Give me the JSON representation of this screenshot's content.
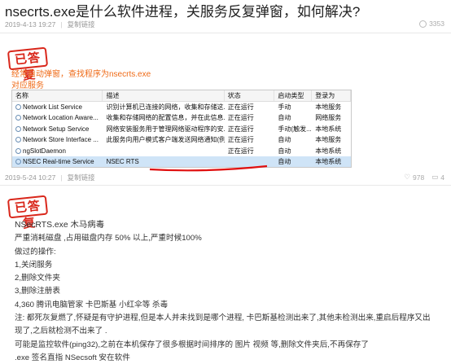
{
  "question": {
    "title": "nsecrts.exe是什么软件进程，关服务反复弹窗，如何解决?",
    "date": "2019-4-13 19:27",
    "copy_link": "复制链接",
    "views": "3353"
  },
  "answer1": {
    "stamp": "已答复",
    "line1": "经常自动弹窗，查找程序为nsecrts.exe",
    "line2": "对应服务",
    "services": {
      "headers": [
        "名称",
        "描述",
        "状态",
        "启动类型",
        "登录为"
      ],
      "rows": [
        {
          "name": "Network List Service",
          "desc": "识别计算机已连接的网络，收集和存储这...",
          "status": "正在运行",
          "startup": "手动",
          "logon": "本地服务",
          "selected": false
        },
        {
          "name": "Network Location Aware...",
          "desc": "收集和存储网络的配置信息，并在此信息...",
          "status": "正在运行",
          "startup": "自动",
          "logon": "网络服务",
          "selected": false
        },
        {
          "name": "Network Setup Service",
          "desc": "网络安装服务用于管理网络驱动程序的安...",
          "status": "正在运行",
          "startup": "手动(触发...",
          "logon": "本地系统",
          "selected": false
        },
        {
          "name": "Network Store Interface ...",
          "desc": "此服务向用户模式客户端发送网络通知(例...",
          "status": "正在运行",
          "startup": "自动",
          "logon": "本地服务",
          "selected": false
        },
        {
          "name": "ngSlotDaemon",
          "desc": "",
          "status": "正在运行",
          "startup": "自动",
          "logon": "本地系统",
          "selected": false
        },
        {
          "name": "NSEC Real-time Service",
          "desc": "NSEC RTS",
          "status": "",
          "startup": "自动",
          "logon": "本地系统",
          "selected": true
        }
      ]
    },
    "date": "2019-5-24 10:27",
    "copy_link": "复制链接",
    "likes": "978",
    "comments": "4"
  },
  "answer2": {
    "stamp": "已答复",
    "lines": [
      "NSecRTS.exe  木马病毒",
      "严重消耗磁盘 ,占用磁盘内存 50% 以上,严重时候100%",
      "做过的操作:",
      "1,关闭服务",
      "2,删除文件夹",
      "3,删除注册表",
      "4,360 腾讯电脑管家 卡巴斯基 小红伞等 杀毒",
      "注: 都死灰复燃了,怀疑是有守护进程,但是本人并未找到是哪个进程, 卡巴斯基检测出来了,其他未检测出来,重启后程序又出",
      "现了,之后就检测不出来了 .",
      " 可能是监控软件(ping32),之前在本机保存了很多根据时间排序的 图片 视频 等,删除文件夹后,不再保存了",
      ".exe 签名直指 NSecsoft 安在软件"
    ]
  }
}
